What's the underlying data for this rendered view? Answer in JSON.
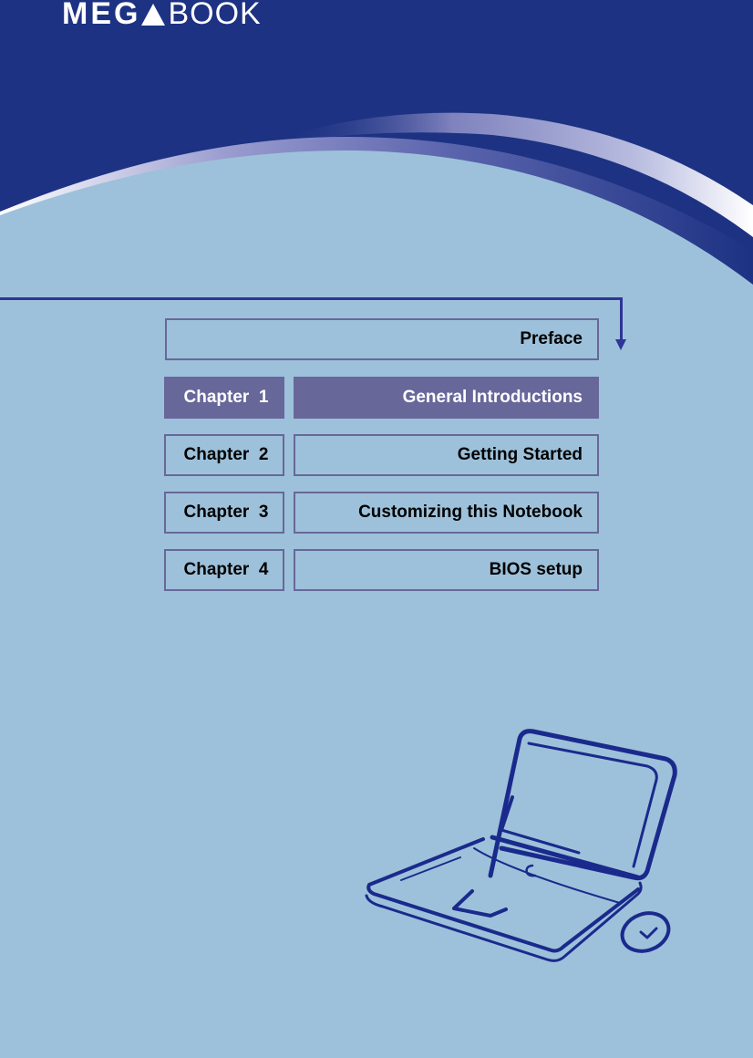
{
  "brand": {
    "logo_left": "MEG",
    "logo_right": "BOOK",
    "colors": {
      "header_navy": "#1d3283",
      "page_background": "#9dc1da",
      "box_accent": "#68679a",
      "connector": "#2f3596",
      "sketch_ink": "#1a2a8c"
    }
  },
  "navigation": {
    "preface": {
      "label": "Preface"
    },
    "chapters": [
      {
        "chapter": "Chapter  1",
        "title": "General Introductions",
        "active": true
      },
      {
        "chapter": "Chapter  2",
        "title": "Getting Started",
        "active": false
      },
      {
        "chapter": "Chapter  3",
        "title": "Customizing this Notebook",
        "active": false
      },
      {
        "chapter": "Chapter  4",
        "title": "BIOS setup",
        "active": false
      }
    ]
  },
  "illustration": {
    "icon": "laptop-with-mouse-sketch"
  }
}
